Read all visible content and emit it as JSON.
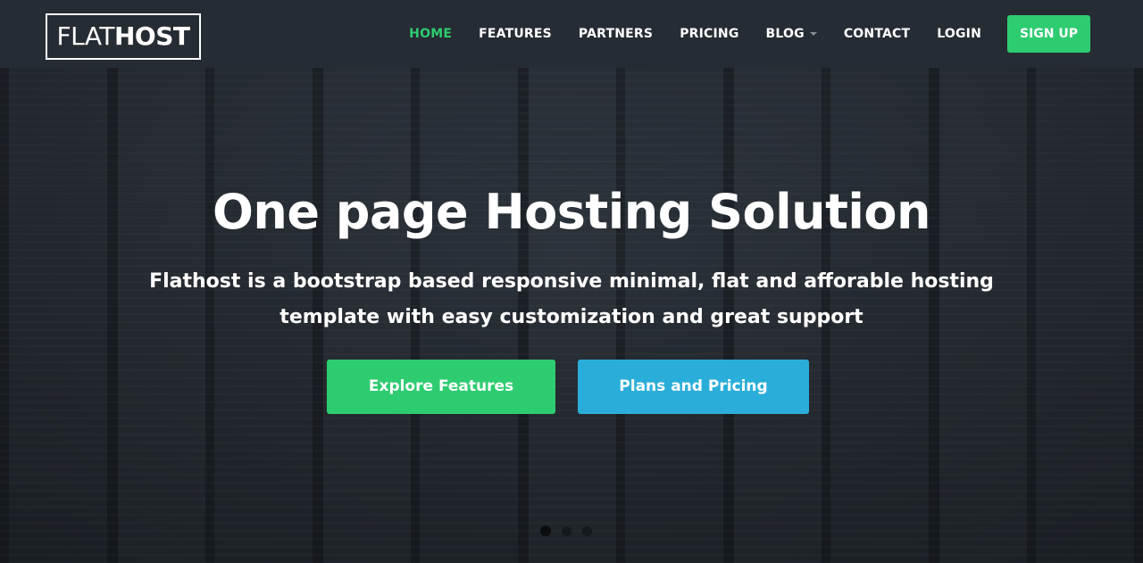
{
  "brand": {
    "logo_light": "FLAT",
    "logo_bold": "HOST"
  },
  "nav": {
    "items": [
      {
        "label": "HOME",
        "active": true
      },
      {
        "label": "FEATURES",
        "active": false
      },
      {
        "label": "PARTNERS",
        "active": false
      },
      {
        "label": "PRICING",
        "active": false
      },
      {
        "label": "BLOG",
        "active": false,
        "dropdown": true
      },
      {
        "label": "CONTACT",
        "active": false
      },
      {
        "label": "LOGIN",
        "active": false
      }
    ],
    "signup_label": "SIGN UP"
  },
  "hero": {
    "title": "One page Hosting Solution",
    "subtitle": "Flathost is a bootstrap based responsive minimal, flat and afforable hosting template with easy customization and great support",
    "primary_button": "Explore Features",
    "secondary_button": "Plans and Pricing",
    "slider": {
      "total_slides": 3,
      "active_slide": 1
    }
  },
  "colors": {
    "accent_green": "#2ecc71",
    "accent_blue": "#2aaed9",
    "navbar_bg": "#262c33",
    "text_white": "#ffffff"
  },
  "icons": {
    "dropdown": "caret-down-icon"
  }
}
